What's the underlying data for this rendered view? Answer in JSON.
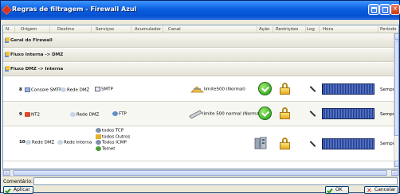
{
  "window": {
    "title": "Regras de filtragem - Firewall Azul"
  },
  "columns": [
    "N.",
    "Origem",
    "Destino",
    "Serviços",
    "Acumulador",
    "Canal",
    "Ação",
    "Restrições",
    "Log",
    "Hora",
    "Período"
  ],
  "groups": [
    {
      "label": "Geral do Firewall"
    },
    {
      "label": "Fluxo Interna -> DMZ"
    },
    {
      "label": "Fluxo DMZ -> Interna"
    }
  ],
  "rows": [
    {
      "number": "8",
      "origin": "Console SMTP",
      "destination": "Rede DMZ",
      "services": [
        "SMTP"
      ],
      "channel": "limite500 (Normal)",
      "period": "Sempre"
    },
    {
      "number": "9",
      "origin": "NT2",
      "destination": "Rede DMZ",
      "services": [
        "FTP"
      ],
      "channel": "limite 500 normal (Normal)",
      "period": "Sempre"
    },
    {
      "number": "10",
      "origin": "Rede DMZ",
      "destination": "Rede Interna",
      "services": [
        "todos TCP",
        "todos Outros",
        "Todos ICMP",
        "Telnet"
      ],
      "channel": "",
      "period": "Sempre"
    }
  ],
  "footer": {
    "comment_label": "Comentário:",
    "comment_value": "",
    "apply_label": "Aplicar",
    "ok_label": "OK",
    "cancel_label": "Cancelar"
  }
}
